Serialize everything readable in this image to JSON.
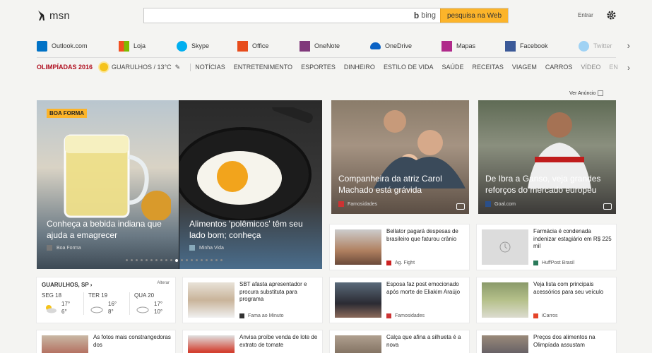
{
  "header": {
    "logo_text": "msn",
    "search_value": "",
    "bing_label": "bing",
    "search_button": "pesquisa na Web",
    "signin": "Entrar"
  },
  "apps": [
    {
      "label": "Outlook.com",
      "icon": "outlook-icon",
      "color": "#0072c6"
    },
    {
      "label": "Loja",
      "icon": "store-icon",
      "color": "#00a4ef"
    },
    {
      "label": "Skype",
      "icon": "skype-icon",
      "color": "#00aff0"
    },
    {
      "label": "Office",
      "icon": "office-icon",
      "color": "#e74c1c"
    },
    {
      "label": "OneNote",
      "icon": "onenote-icon",
      "color": "#80397b"
    },
    {
      "label": "OneDrive",
      "icon": "onedrive-icon",
      "color": "#0a62c5"
    },
    {
      "label": "Mapas",
      "icon": "maps-icon",
      "color": "#b02a8b"
    },
    {
      "label": "Facebook",
      "icon": "facebook-icon",
      "color": "#3b5998"
    },
    {
      "label": "Twitter",
      "icon": "twitter-icon",
      "color": "#55acee"
    }
  ],
  "nav": {
    "olympics": "OLIMPÍADAS 2016",
    "weather": "GUARULHOS / 13°C",
    "categories": [
      "NOTÍCIAS",
      "ENTRETENIMENTO",
      "ESPORTES",
      "DINHEIRO",
      "ESTILO DE VIDA",
      "SAÚDE",
      "RECEITAS",
      "VIAGEM",
      "CARROS",
      "VÍDEO"
    ],
    "more": "EN"
  },
  "ad_link": "Ver Anúncio",
  "hero": {
    "tag": "BOA FORMA",
    "slides": [
      {
        "caption": "Conheça a bebida indiana que ajuda a emagrecer",
        "source": "Boa Forma"
      },
      {
        "caption": "Alimentos 'polêmicos' têm seu lado bom; conheça",
        "source": "Minha Vida"
      }
    ]
  },
  "tiles": [
    {
      "caption": "Companheira da atriz Carol Machado está grávida",
      "source": "Famosidades"
    },
    {
      "caption": "De Ibra a Ganso, veja grandes reforços do mercado europeu",
      "source": "Goal.com"
    }
  ],
  "cards_row1": [
    {
      "title": "Bellator pagará despesas de brasileiro que faturou crânio",
      "source": "Ag. Fight"
    },
    {
      "title": "Farmácia é condenada indenizar estagiário em R$ 225 mil",
      "source": "HuffPost Brasil"
    }
  ],
  "weather_card": {
    "city": "GUARULHOS, SP",
    "alter": "Alterar",
    "days": [
      {
        "name": "SEG 18",
        "hi": "17°",
        "lo": "6°"
      },
      {
        "name": "TER 19",
        "hi": "16°",
        "lo": "8°"
      },
      {
        "name": "QUA 20",
        "hi": "17°",
        "lo": "10°"
      }
    ]
  },
  "cards_row2": [
    {
      "title": "SBT afasta apresentador e procura substituta para programa",
      "source": "Fama ao Minuto"
    },
    {
      "title": "Esposa faz post emocionado após morte de Eliakim Araújo",
      "source": "Famosidades"
    },
    {
      "title": "Veja lista com principais acessórios para seu veículo",
      "source": "iCarros"
    }
  ],
  "cards_row3": [
    {
      "title": "As fotos mais constrangedoras dos"
    },
    {
      "title": "Anvisa proíbe venda de lote de extrato de tomate"
    },
    {
      "title": "Calça que afina a silhueta é a nova"
    },
    {
      "title": "Preços dos alimentos na Olimpíada assustam"
    }
  ],
  "slide_dots": {
    "count": 20,
    "active": 10
  }
}
